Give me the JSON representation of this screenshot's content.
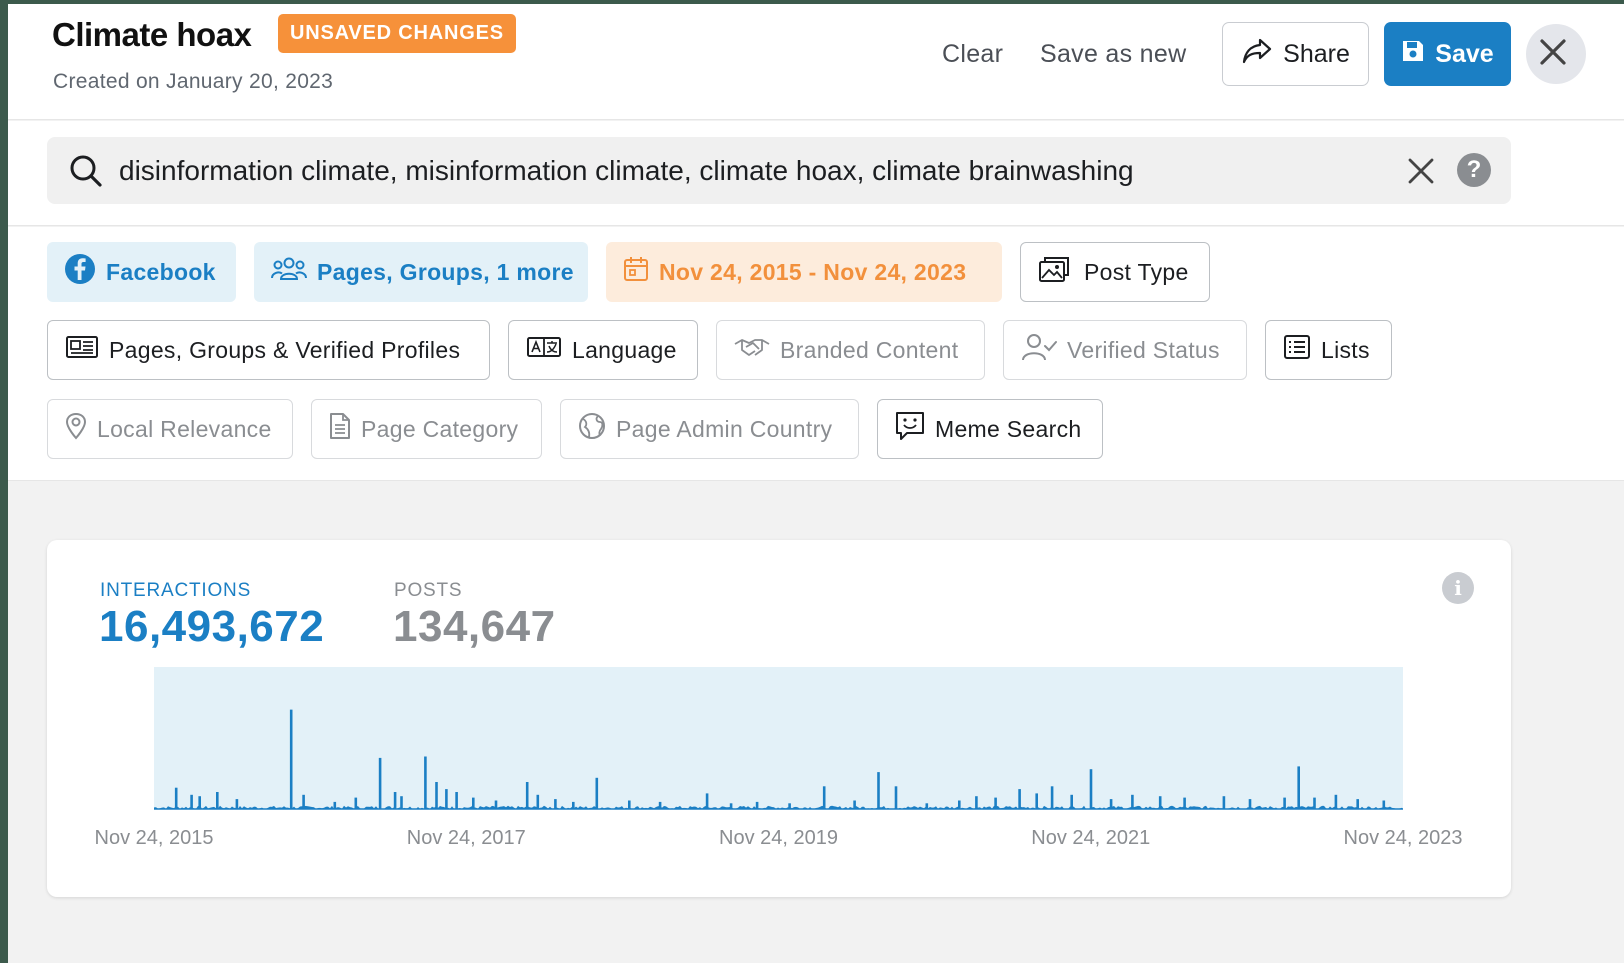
{
  "header": {
    "title": "Climate hoax",
    "badge": "UNSAVED CHANGES",
    "created": "Created on January 20, 2023",
    "clear_label": "Clear",
    "save_as_new_label": "Save as new",
    "share_label": "Share",
    "save_label": "Save"
  },
  "search": {
    "query": "disinformation climate, misinformation climate, climate hoax, climate brainwashing"
  },
  "filters": {
    "platform": "Facebook",
    "sources": "Pages, Groups, 1 more",
    "date_range": "Nov 24, 2015 - Nov 24, 2023",
    "post_type": "Post Type",
    "profiles": "Pages, Groups & Verified Profiles",
    "language": "Language",
    "branded_content": "Branded Content",
    "verified_status": "Verified Status",
    "lists": "Lists",
    "local_relevance": "Local Relevance",
    "page_category": "Page Category",
    "page_admin_country": "Page Admin Country",
    "meme_search": "Meme Search"
  },
  "stats": {
    "interactions_label": "INTERACTIONS",
    "interactions_value": "16,493,672",
    "posts_label": "POSTS",
    "posts_value": "134,647"
  },
  "colors": {
    "accent": "#1b7fc4",
    "badge": "#f6913a",
    "date_chip": "#f2903c",
    "chart_fill": "#e3f1f8",
    "chart_line": "#1b7fc4"
  },
  "chart_data": {
    "type": "line",
    "series_label": "Interactions",
    "x_ticks": [
      "Nov 24, 2015",
      "Nov 24, 2017",
      "Nov 24, 2019",
      "Nov 24, 2021",
      "Nov 24, 2023"
    ],
    "x_range": [
      "2015-11-24",
      "2023-11-24"
    ],
    "y_max": 100,
    "grid": false,
    "spikes": [
      {
        "x": "2016-01-15",
        "y": 15
      },
      {
        "x": "2016-02-20",
        "y": 10
      },
      {
        "x": "2016-03-10",
        "y": 9
      },
      {
        "x": "2016-04-20",
        "y": 12
      },
      {
        "x": "2016-06-05",
        "y": 7
      },
      {
        "x": "2016-10-10",
        "y": 70
      },
      {
        "x": "2016-11-08",
        "y": 10
      },
      {
        "x": "2017-01-20",
        "y": 5
      },
      {
        "x": "2017-03-10",
        "y": 8
      },
      {
        "x": "2017-05-06",
        "y": 36
      },
      {
        "x": "2017-06-10",
        "y": 12
      },
      {
        "x": "2017-06-25",
        "y": 9
      },
      {
        "x": "2017-08-20",
        "y": 37
      },
      {
        "x": "2017-09-15",
        "y": 19
      },
      {
        "x": "2017-10-08",
        "y": 14
      },
      {
        "x": "2017-11-01",
        "y": 12
      },
      {
        "x": "2017-12-10",
        "y": 8
      },
      {
        "x": "2018-02-01",
        "y": 6
      },
      {
        "x": "2018-04-15",
        "y": 19
      },
      {
        "x": "2018-05-10",
        "y": 10
      },
      {
        "x": "2018-06-20",
        "y": 7
      },
      {
        "x": "2018-08-01",
        "y": 5
      },
      {
        "x": "2018-09-25",
        "y": 22
      },
      {
        "x": "2018-12-10",
        "y": 6
      },
      {
        "x": "2019-02-20",
        "y": 5
      },
      {
        "x": "2019-06-10",
        "y": 11
      },
      {
        "x": "2019-08-05",
        "y": 4
      },
      {
        "x": "2019-10-05",
        "y": 5
      },
      {
        "x": "2019-12-20",
        "y": 4
      },
      {
        "x": "2020-03-10",
        "y": 16
      },
      {
        "x": "2020-05-20",
        "y": 6
      },
      {
        "x": "2020-07-15",
        "y": 26
      },
      {
        "x": "2020-08-25",
        "y": 16
      },
      {
        "x": "2020-11-05",
        "y": 4
      },
      {
        "x": "2021-01-20",
        "y": 6
      },
      {
        "x": "2021-03-01",
        "y": 9
      },
      {
        "x": "2021-04-15",
        "y": 8
      },
      {
        "x": "2021-06-10",
        "y": 14
      },
      {
        "x": "2021-07-20",
        "y": 11
      },
      {
        "x": "2021-08-25",
        "y": 16
      },
      {
        "x": "2021-10-10",
        "y": 10
      },
      {
        "x": "2021-11-24",
        "y": 28
      },
      {
        "x": "2022-01-10",
        "y": 7
      },
      {
        "x": "2022-03-01",
        "y": 10
      },
      {
        "x": "2022-05-05",
        "y": 9
      },
      {
        "x": "2022-07-01",
        "y": 8
      },
      {
        "x": "2022-10-01",
        "y": 9
      },
      {
        "x": "2022-12-01",
        "y": 7
      },
      {
        "x": "2023-02-20",
        "y": 8
      },
      {
        "x": "2023-03-25",
        "y": 30
      },
      {
        "x": "2023-05-01",
        "y": 8
      },
      {
        "x": "2023-06-20",
        "y": 10
      },
      {
        "x": "2023-08-10",
        "y": 7
      },
      {
        "x": "2023-10-10",
        "y": 6
      }
    ]
  }
}
